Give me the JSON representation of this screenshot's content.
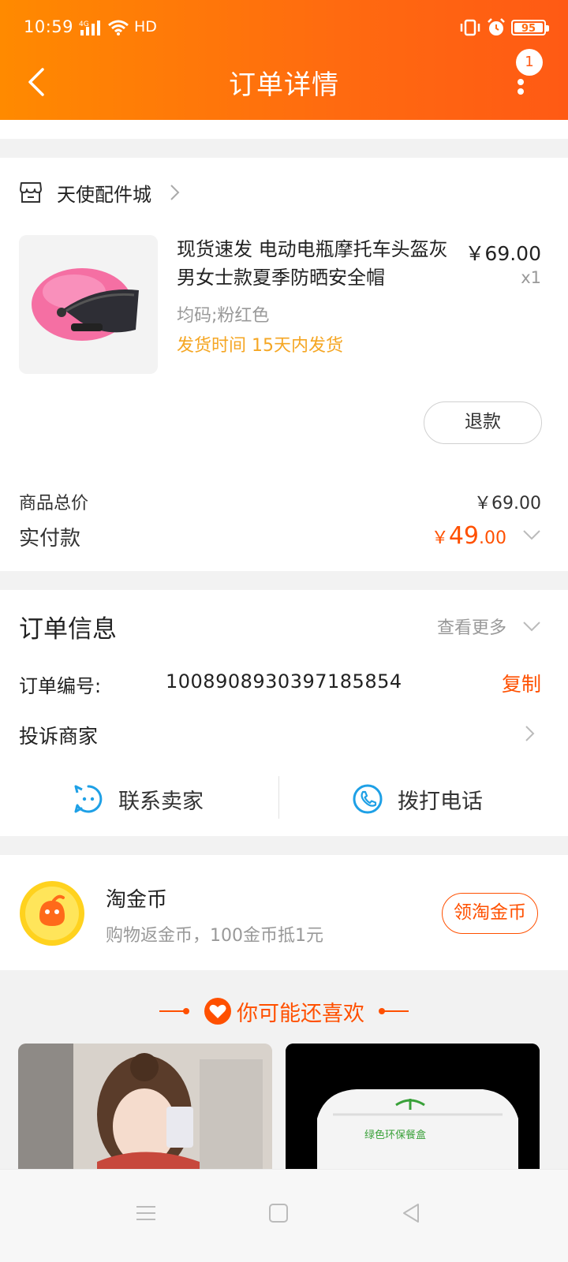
{
  "status_bar": {
    "time": "10:59",
    "network": "HD",
    "battery": "95"
  },
  "header": {
    "title": "订单详情",
    "notification_count": "1"
  },
  "store": {
    "name": "天使配件城"
  },
  "product": {
    "title": "现货速发 电动电瓶摩托车头盔灰男女士款夏季防晒安全帽",
    "price": "￥69.00",
    "quantity": "x1",
    "sku": "均码;粉红色",
    "shipping": "发货时间 15天内发货",
    "refund_label": "退款"
  },
  "summary": {
    "total_label": "商品总价",
    "total_value": "￥69.00",
    "paid_label": "实付款",
    "paid_symbol": "￥",
    "paid_int": "49",
    "paid_dec": ".00"
  },
  "order_info": {
    "title": "订单信息",
    "more_label": "查看更多",
    "order_no_label": "订单编号:",
    "order_no": "1008908930397185854",
    "copy_label": "复制",
    "complain_label": "投诉商家",
    "contact_seller": "联系卖家",
    "call_phone": "拨打电话"
  },
  "coins": {
    "title": "淘金币",
    "desc": "购物返金币，100金币抵1元",
    "button": "领淘金币"
  },
  "recommend": {
    "title": "你可能还喜欢",
    "product_2_logo_text": "绿色环保餐盒"
  },
  "colors": {
    "accent": "#ff5000",
    "header_start": "#ff8a00",
    "header_end": "#ff5a14",
    "shipping": "#f5a623",
    "icon_blue": "#1ea0e6"
  }
}
